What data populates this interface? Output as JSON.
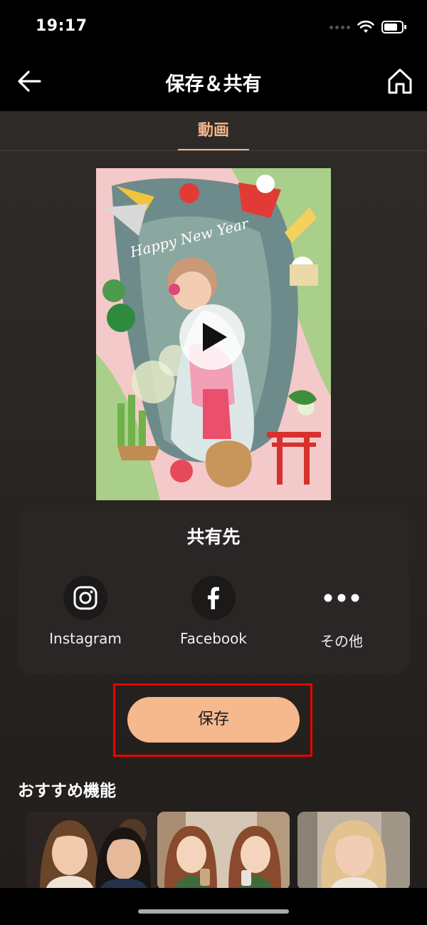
{
  "status": {
    "time": "19:17"
  },
  "header": {
    "title": "保存＆共有"
  },
  "tabs": [
    {
      "label": "動画",
      "active": true
    }
  ],
  "preview": {
    "greeting": "Happy New Year"
  },
  "share": {
    "title": "共有先",
    "items": [
      {
        "label": "Instagram",
        "icon": "instagram-icon"
      },
      {
        "label": "Facebook",
        "icon": "facebook-icon"
      },
      {
        "label": "その他",
        "icon": "more-icon"
      }
    ]
  },
  "save": {
    "label": "保存"
  },
  "recommend": {
    "title": "おすすめ機能"
  },
  "colors": {
    "accent": "#f6b88d",
    "tab_active": "#f4b68b",
    "highlight": "#e00000"
  }
}
